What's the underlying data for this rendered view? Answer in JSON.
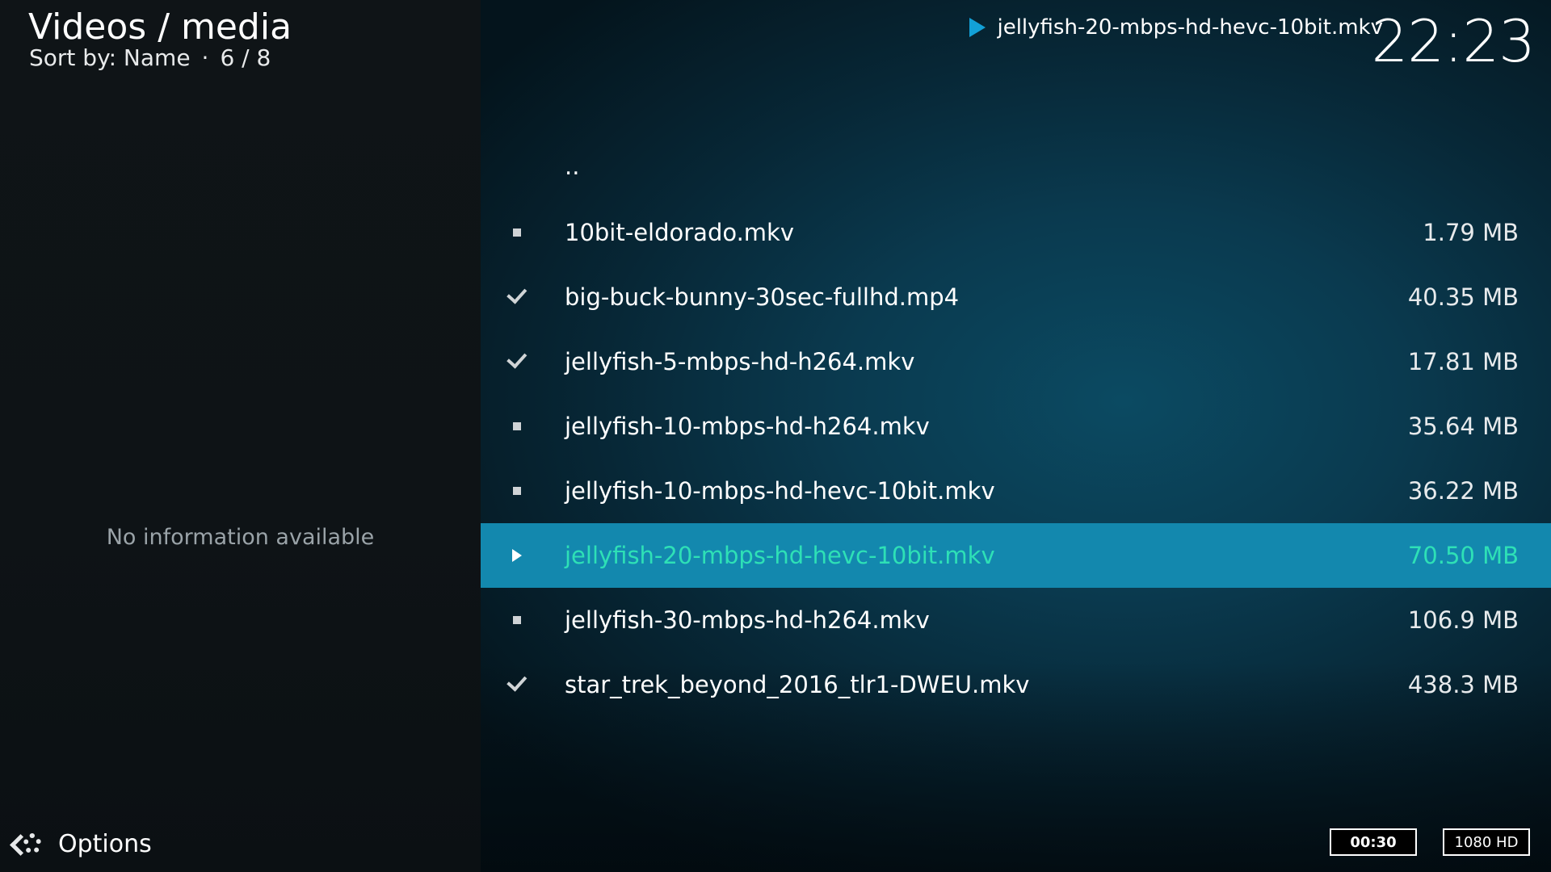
{
  "header": {
    "title": "Videos / media",
    "sort_label": "Sort by: Name",
    "separator": "·",
    "position": "6 / 8"
  },
  "now_playing": {
    "title": "jellyfish-20-mbps-hd-hevc-10bit.mkv",
    "icon": "play-icon"
  },
  "clock": "22:23",
  "info_panel": {
    "message": "No information available"
  },
  "file_list": {
    "parent_label": "..",
    "items": [
      {
        "name": "10bit-eldorado.mkv",
        "size": "1.79 MB",
        "status": "unwatched"
      },
      {
        "name": "big-buck-bunny-30sec-fullhd.mp4",
        "size": "40.35 MB",
        "status": "watched"
      },
      {
        "name": "jellyfish-5-mbps-hd-h264.mkv",
        "size": "17.81 MB",
        "status": "watched"
      },
      {
        "name": "jellyfish-10-mbps-hd-h264.mkv",
        "size": "35.64 MB",
        "status": "unwatched"
      },
      {
        "name": "jellyfish-10-mbps-hd-hevc-10bit.mkv",
        "size": "36.22 MB",
        "status": "unwatched"
      },
      {
        "name": "jellyfish-20-mbps-hd-hevc-10bit.mkv",
        "size": "70.50 MB",
        "status": "playing",
        "selected": true
      },
      {
        "name": "jellyfish-30-mbps-hd-h264.mkv",
        "size": "106.9 MB",
        "status": "unwatched"
      },
      {
        "name": "star_trek_beyond_2016_tlr1-DWEU.mkv",
        "size": "438.3 MB",
        "status": "watched"
      }
    ]
  },
  "footer": {
    "options_label": "Options",
    "duration_badge": "00:30",
    "resolution_badge": "1080 HD"
  },
  "colors": {
    "accent": "#12a0d7",
    "selected_row": "#1388ae",
    "selected_text": "#2ee0b6"
  }
}
